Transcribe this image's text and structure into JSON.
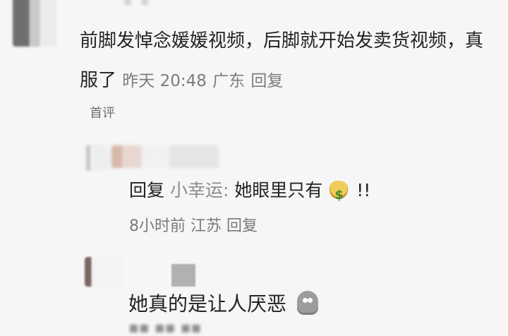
{
  "top_comment": {
    "text": "前脚发悼念媛媛视频，后脚就开始发卖货视频，真服了",
    "time": "昨天 20:48",
    "location": "广东",
    "reply": "回复"
  },
  "section": {
    "label": "首评"
  },
  "reply_comment": {
    "prefix": "回复",
    "user": "小幸运:",
    "text": "她眼里只有",
    "suffix": "!!",
    "time": "8小时前",
    "location": "江苏",
    "reply": "回复"
  },
  "bottom_comment": {
    "text": "她真的是让人厌恶"
  },
  "icons": {
    "money": "money-bag-icon",
    "ghost": "ghost-icon"
  },
  "colors": {
    "background": "#f6f6f6",
    "text": "#232323",
    "meta": "#7c7c7c",
    "username": "#8c8c8c"
  }
}
